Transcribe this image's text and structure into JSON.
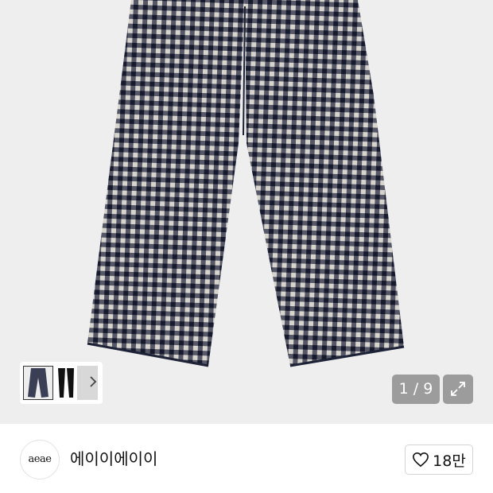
{
  "gallery": {
    "image_alt": "checkered wide pants",
    "counter": "1 / 9",
    "expand_icon": "expand-icon",
    "next_icon": "chevron-right-icon"
  },
  "seller": {
    "logo_text": "aeae",
    "name": "에이이에이이",
    "like_icon": "heart-outline-icon",
    "like_count": "18만"
  },
  "colors": {
    "hero_background": "#eeeeef",
    "overlay_button": "#9c9c9c",
    "check_dark": "#2a2f45",
    "check_light": "#d6d4cc"
  }
}
